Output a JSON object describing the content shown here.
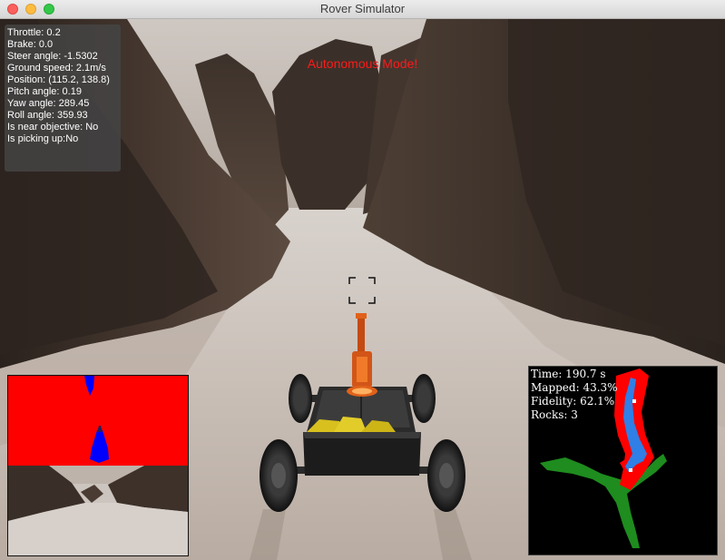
{
  "window": {
    "title": "Rover Simulator"
  },
  "hud": {
    "throttle": "Throttle: 0.2",
    "brake": "Brake: 0.0",
    "steer_angle": "Steer angle: -1.5302",
    "ground_speed": "Ground speed: 2.1m/s",
    "position": "Position: (115.2, 138.8)",
    "pitch_angle": "Pitch angle: 0.19",
    "yaw_angle": "Yaw angle: 289.45",
    "roll_angle": "Roll angle: 359.93",
    "near_objective": "Is near objective: No",
    "picking_up": "Is picking up:No"
  },
  "mode_banner": "Autonomous Mode!",
  "worldmap": {
    "time": "Time: 190.7 s",
    "mapped": "Mapped: 43.3%",
    "fidelity": "Fidelity: 62.1%",
    "rocks": "Rocks: 3"
  },
  "colors": {
    "banner": "#ff1a1a",
    "navigable": "#0000ff",
    "obstacle": "#ff0000",
    "ground_truth": "#1e8c1e"
  },
  "icons": {
    "camera_reticle": "crosshair-reticle-icon"
  }
}
